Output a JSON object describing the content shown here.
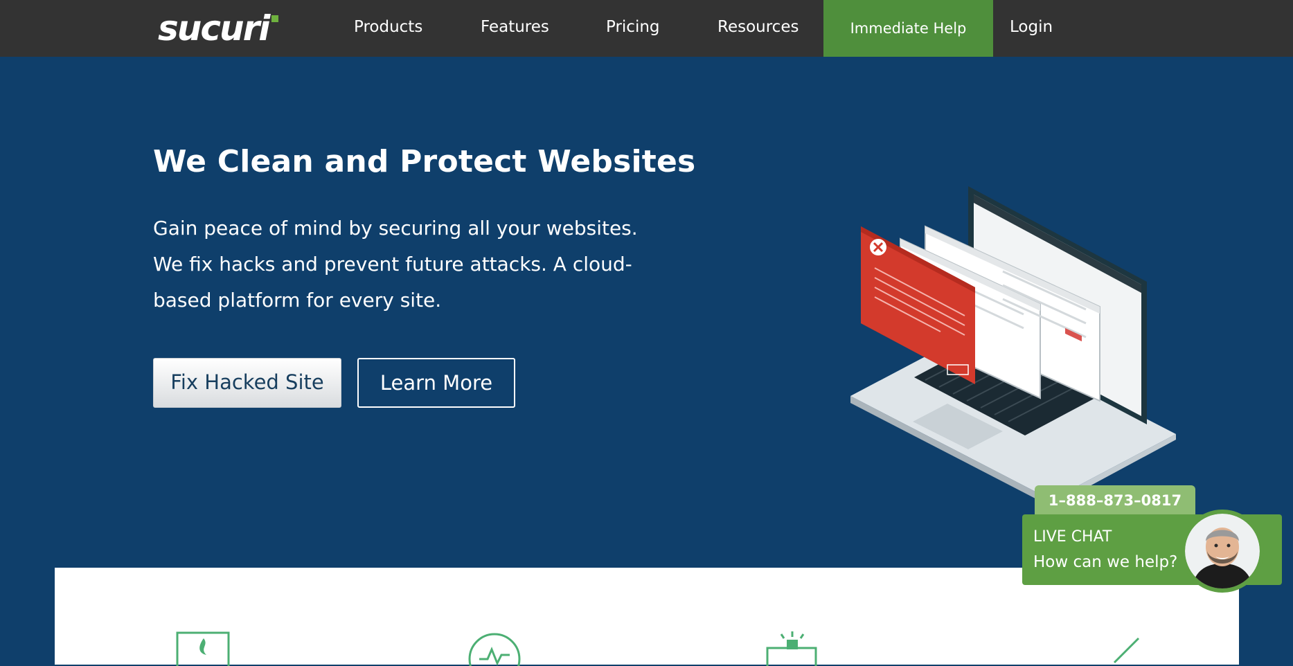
{
  "nav": {
    "logo_text": "sucuri",
    "items": [
      "Products",
      "Features",
      "Pricing",
      "Resources"
    ],
    "help_label": "Immediate Help",
    "login_label": "Login"
  },
  "hero": {
    "title": "We Clean and Protect Websites",
    "description": "Gain peace of mind by securing all your websites. We fix hacks and prevent future attacks. A cloud-based platform for every site.",
    "primary_button": "Fix Hacked Site",
    "secondary_button": "Learn More"
  },
  "chat": {
    "phone": "1–888–873–0817",
    "title": "LIVE CHAT",
    "subtitle": "How can we help?"
  },
  "colors": {
    "nav_bg": "#333333",
    "hero_bg": "#0f3f6b",
    "accent_green": "#4f8f3c",
    "chat_green": "#5e9f43",
    "phone_tab_green": "#8fbd73",
    "alert_red": "#d33a2c"
  },
  "icons": {
    "logo": "sucuri-logo",
    "laptop": "laptop-illustration",
    "feature_1": "flame-icon",
    "feature_2": "pulse-icon",
    "feature_3": "alarm-icon",
    "feature_4": "arrow-icon"
  }
}
